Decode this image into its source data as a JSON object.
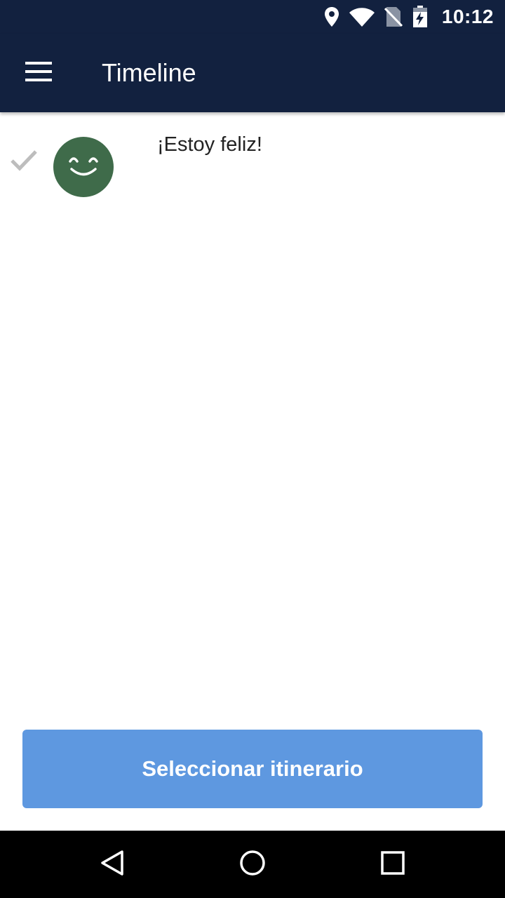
{
  "status_bar": {
    "time": "10:12",
    "icons": [
      "location-icon",
      "wifi-icon",
      "no-sim-icon",
      "battery-charging-icon"
    ]
  },
  "app_bar": {
    "title": "Timeline",
    "menu_icon": "hamburger-menu-icon"
  },
  "timeline": {
    "items": [
      {
        "status_icon": "check-icon",
        "mood_icon": "smiley-face-icon",
        "text": "¡Estoy feliz!"
      }
    ]
  },
  "bottom_button": {
    "label": "Seleccionar itinerario"
  },
  "navigation": {
    "icons": [
      "back-icon",
      "home-icon",
      "recent-apps-icon"
    ]
  },
  "colors": {
    "app_bar": "#12213f",
    "avatar": "#3f6b4a",
    "button": "#5e98e0",
    "check": "#bdbdbd"
  }
}
